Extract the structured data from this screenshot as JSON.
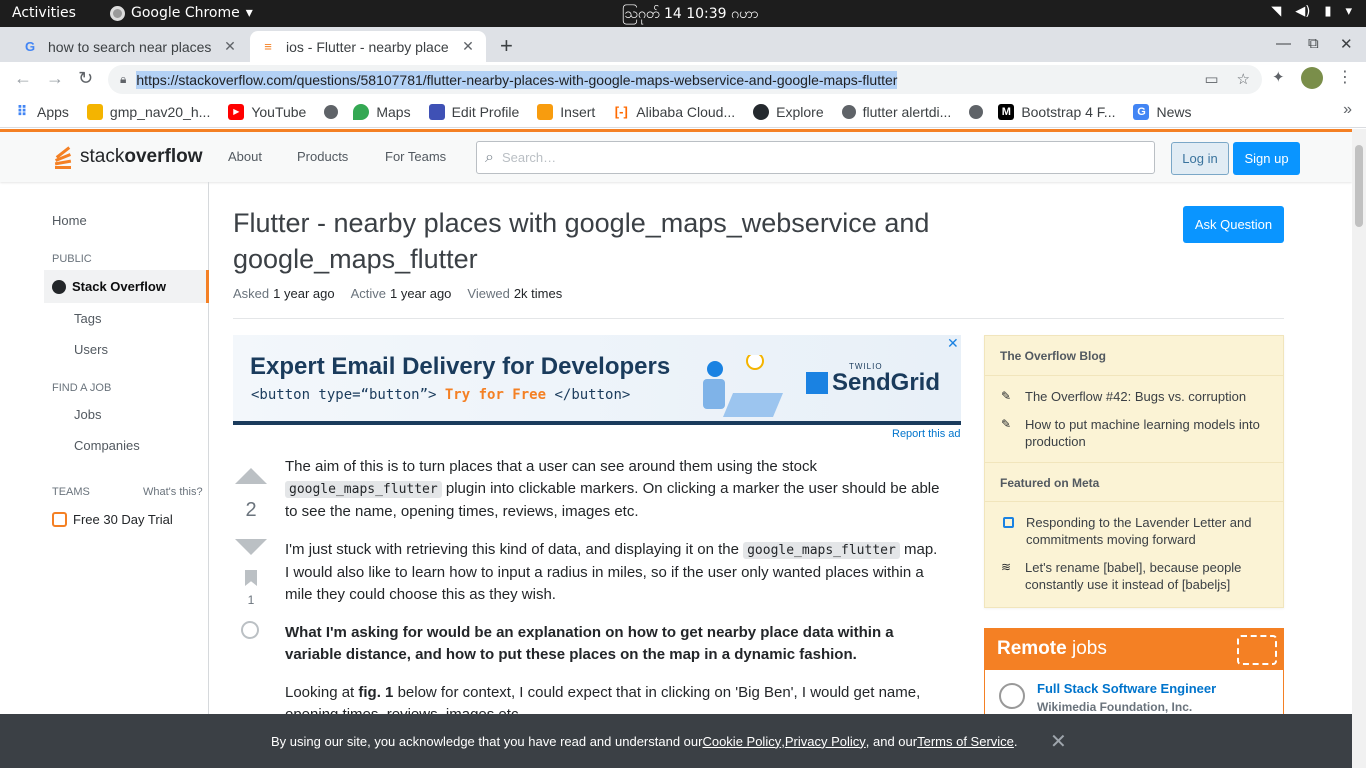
{
  "os": {
    "activities": "Activities",
    "app_name": "Google Chrome",
    "clock": "ဩဂုတ် 14  10:39 ဂဟာ"
  },
  "browser": {
    "tabs": [
      {
        "title": "how to search near places",
        "favicon": "google-icon"
      },
      {
        "title": "ios - Flutter - nearby place",
        "favicon": "stackoverflow-icon"
      }
    ],
    "url": "https://stackoverflow.com/questions/58107781/flutter-nearby-places-with-google-maps-webservice-and-google-maps-flutter",
    "bookmarks": [
      {
        "label": "Apps",
        "icon": "apps-grid-icon",
        "color": "#4285f4"
      },
      {
        "label": "gmp_nav20_h...",
        "icon": "fire-icon",
        "color": "#f4b400"
      },
      {
        "label": "YouTube",
        "icon": "youtube-icon",
        "color": "#ff0000"
      },
      {
        "label": "",
        "icon": "globe-icon",
        "color": "#5f6368"
      },
      {
        "label": "Maps",
        "icon": "maps-pin-icon",
        "color": "#34a853"
      },
      {
        "label": "Edit Profile",
        "icon": "profile-icon",
        "color": "#3f51b5"
      },
      {
        "label": "Insert",
        "icon": "pma-icon",
        "color": "#f89c0e"
      },
      {
        "label": "Alibaba Cloud...",
        "icon": "alibaba-icon",
        "color": "#ff6a00"
      },
      {
        "label": "Explore",
        "icon": "github-icon",
        "color": "#24292e"
      },
      {
        "label": "flutter alertdi...",
        "icon": "globe-icon",
        "color": "#5f6368"
      },
      {
        "label": "",
        "icon": "globe-icon",
        "color": "#5f6368"
      },
      {
        "label": "Bootstrap 4 F...",
        "icon": "medium-icon",
        "color": "#000000"
      },
      {
        "label": "News",
        "icon": "news-icon",
        "color": "#4285f4"
      }
    ]
  },
  "so": {
    "logo_text_a": "stack",
    "logo_text_b": "overflow",
    "nav": [
      "About",
      "Products",
      "For Teams"
    ],
    "search_placeholder": "Search…",
    "login": "Log in",
    "signup": "Sign up",
    "sidebar": {
      "home": "Home",
      "public": "PUBLIC",
      "stack_overflow": "Stack Overflow",
      "tags": "Tags",
      "users": "Users",
      "find_job": "FIND A JOB",
      "jobs": "Jobs",
      "companies": "Companies",
      "teams": "TEAMS",
      "whats_this": "What's this?",
      "trial": "Free 30 Day Trial"
    },
    "question": {
      "title": "Flutter - nearby places with google_maps_webservice and google_maps_flutter",
      "ask_button": "Ask Question",
      "asked_label": "Asked",
      "asked_value": "1 year ago",
      "active_label": "Active",
      "active_value": "1 year ago",
      "viewed_label": "Viewed",
      "viewed_value": "2k times",
      "votes": "2",
      "bookmarks": "1",
      "p1_a": "The aim of this is to turn places that a user can see around them using the stock ",
      "p1_code": "google_maps_flutter",
      "p1_b": " plugin into clickable markers. On clicking a marker the user should be able to see the name, opening times, reviews, images etc.",
      "p2_a": "I'm just stuck with retrieving this kind of data, and displaying it on the ",
      "p2_code": "google_maps_flutter",
      "p2_b": " map. I would also like to learn how to input a radius in miles, so if the user only wanted places within a mile they could choose this as they wish.",
      "p3": "What I'm asking for would be an explanation on how to get nearby place data within a variable distance, and how to put these places on the map in a dynamic fashion.",
      "p4_a": "Looking at ",
      "p4_b": "fig. 1",
      "p4_c": " below for context, I could expect that in clicking on 'Big Ben', I would get name, opening times, reviews, images etc."
    },
    "ad": {
      "headline": "Expert Email Delivery for Developers",
      "code_a": "<button type=“button”> ",
      "code_b": "Try for Free",
      "code_c": " </button>",
      "brand_small": "TWILIO",
      "brand": "SendGrid",
      "report": "Report this ad"
    },
    "blog": {
      "header": "The Overflow Blog",
      "items": [
        "The Overflow #42: Bugs vs. corruption",
        "How to put machine learning models into production"
      ],
      "meta_header": "Featured on Meta",
      "meta_items": [
        "Responding to the Lavender Letter and commitments moving forward",
        "Let's rename [babel], because people constantly use it instead of [babeljs]"
      ]
    },
    "remote": {
      "title_a": "Remote",
      "title_b": " jobs",
      "job": "Full Stack Software Engineer",
      "company": "Wikimedia Foundation, Inc."
    },
    "cookie": {
      "text_a": "By using our site, you acknowledge that you have read and understand our ",
      "cookie_policy": "Cookie Policy",
      "sep1": ", ",
      "privacy": "Privacy Policy",
      "sep2": ", and our ",
      "terms": "Terms of Service",
      "end": "."
    }
  },
  "colors": {
    "so_orange": "#f48024",
    "so_blue": "#0a95ff",
    "link_blue": "#0074cc"
  }
}
